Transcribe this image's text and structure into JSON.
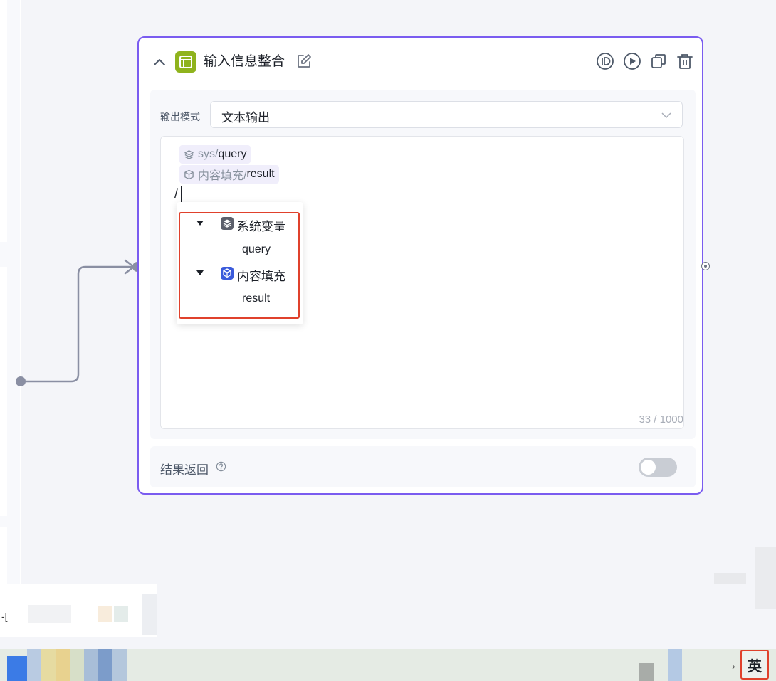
{
  "node": {
    "title": "输入信息整合",
    "toolbar": [
      "id-icon",
      "run-icon",
      "copy-icon",
      "delete-icon"
    ]
  },
  "output_mode": {
    "label": "输出模式",
    "value": "文本输出"
  },
  "editor": {
    "tags": [
      {
        "prefix": "sys/",
        "leaf": "query",
        "icon": "layers-icon"
      },
      {
        "prefix": "内容填充/",
        "leaf": "result",
        "icon": "cube-icon"
      }
    ],
    "typed": "/",
    "counter": "33 / 1000"
  },
  "dropdown": {
    "groups": [
      {
        "label": "系统变量",
        "icon": "layers-icon",
        "icon_color": "#5b5f6b",
        "children": [
          "query"
        ]
      },
      {
        "label": "内容填充",
        "icon": "cube-icon",
        "icon_color": "#3b5bdb",
        "children": [
          "result"
        ]
      }
    ]
  },
  "footer": {
    "label": "结果返回",
    "toggle_on": false
  },
  "ime": {
    "label": "英"
  },
  "colors": {
    "accent": "#7a5cf0",
    "node_icon": "#8fb31d",
    "highlight": "#e0412c"
  }
}
